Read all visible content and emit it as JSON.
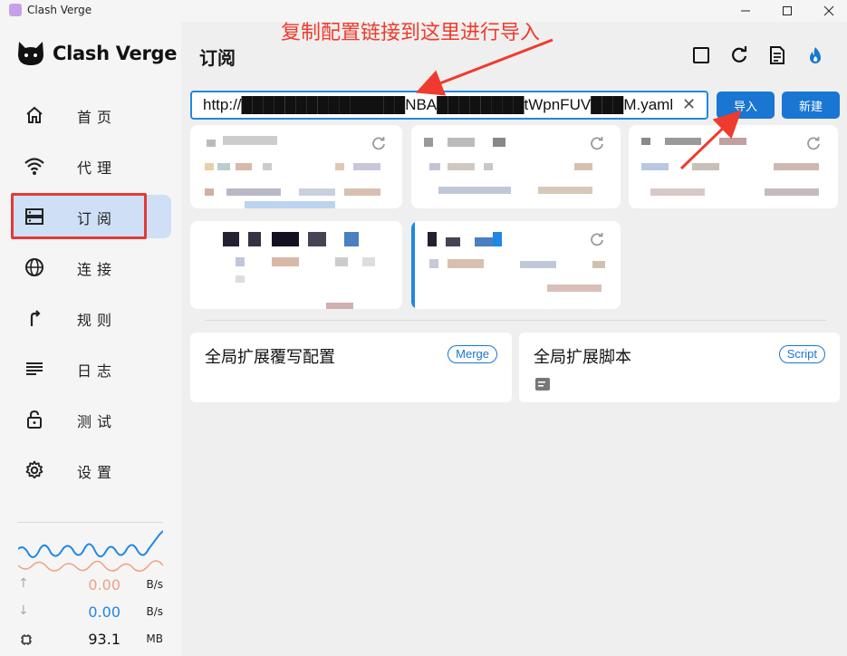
{
  "window": {
    "title": "Clash Verge"
  },
  "sidebar": {
    "app_name": "Clash Verge",
    "items": [
      {
        "label": "首页",
        "icon": "home-icon",
        "active": false
      },
      {
        "label": "代理",
        "icon": "wifi-icon",
        "active": false
      },
      {
        "label": "订阅",
        "icon": "storage-icon",
        "active": true
      },
      {
        "label": "连接",
        "icon": "globe-icon",
        "active": false
      },
      {
        "label": "规则",
        "icon": "fork-arrow-icon",
        "active": false
      },
      {
        "label": "日志",
        "icon": "lines-icon",
        "active": false
      },
      {
        "label": "测试",
        "icon": "lock-icon",
        "active": false
      },
      {
        "label": "设置",
        "icon": "gear-icon",
        "active": false
      }
    ],
    "traffic": {
      "up": {
        "value": "0.00",
        "unit": "B/s"
      },
      "down": {
        "value": "0.00",
        "unit": "B/s"
      },
      "memory": {
        "value": "93.1",
        "unit": "MB"
      }
    }
  },
  "main": {
    "title": "订阅",
    "annotation": "复制配置链接到这里进行导入",
    "url_input": {
      "value": "http://███████████████NBA████████tWpnFUV███M.yaml"
    },
    "import_label": "导入",
    "new_label": "新建",
    "extensions": [
      {
        "title": "全局扩展覆写配置",
        "badge": "Merge"
      },
      {
        "title": "全局扩展脚本",
        "badge": "Script"
      }
    ]
  },
  "colors": {
    "accent": "#1976d2",
    "annotation": "#ef3b2d",
    "active_nav": "#cfe0f6",
    "upload": "#f0a080",
    "download": "#1e88e5"
  }
}
